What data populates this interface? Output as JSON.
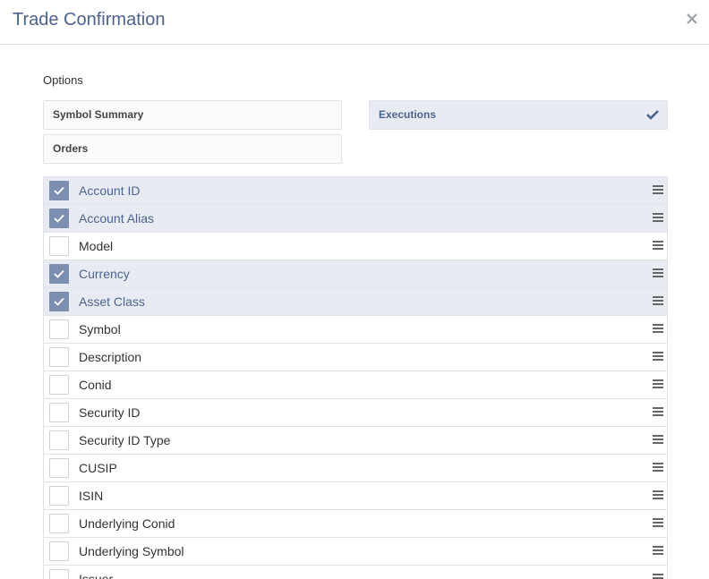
{
  "header": {
    "title": "Trade Confirmation",
    "close_icon": "close-icon"
  },
  "options": {
    "label": "Options",
    "items": [
      {
        "label": "Symbol Summary",
        "selected": false
      },
      {
        "label": "Executions",
        "selected": true
      },
      {
        "label": "Orders",
        "selected": false
      }
    ]
  },
  "columns": [
    {
      "label": "Account ID",
      "checked": true
    },
    {
      "label": "Account Alias",
      "checked": true
    },
    {
      "label": "Model",
      "checked": false
    },
    {
      "label": "Currency",
      "checked": true
    },
    {
      "label": "Asset Class",
      "checked": true
    },
    {
      "label": "Symbol",
      "checked": false
    },
    {
      "label": "Description",
      "checked": false
    },
    {
      "label": "Conid",
      "checked": false
    },
    {
      "label": "Security ID",
      "checked": false
    },
    {
      "label": "Security ID Type",
      "checked": false
    },
    {
      "label": "CUSIP",
      "checked": false
    },
    {
      "label": "ISIN",
      "checked": false
    },
    {
      "label": "Underlying Conid",
      "checked": false
    },
    {
      "label": "Underlying Symbol",
      "checked": false
    },
    {
      "label": "Issuer",
      "checked": false
    }
  ],
  "colors": {
    "accent": "#4c6391",
    "checked_bg": "#e8ecf2",
    "checkbox_fill": "#7d8fb0"
  }
}
